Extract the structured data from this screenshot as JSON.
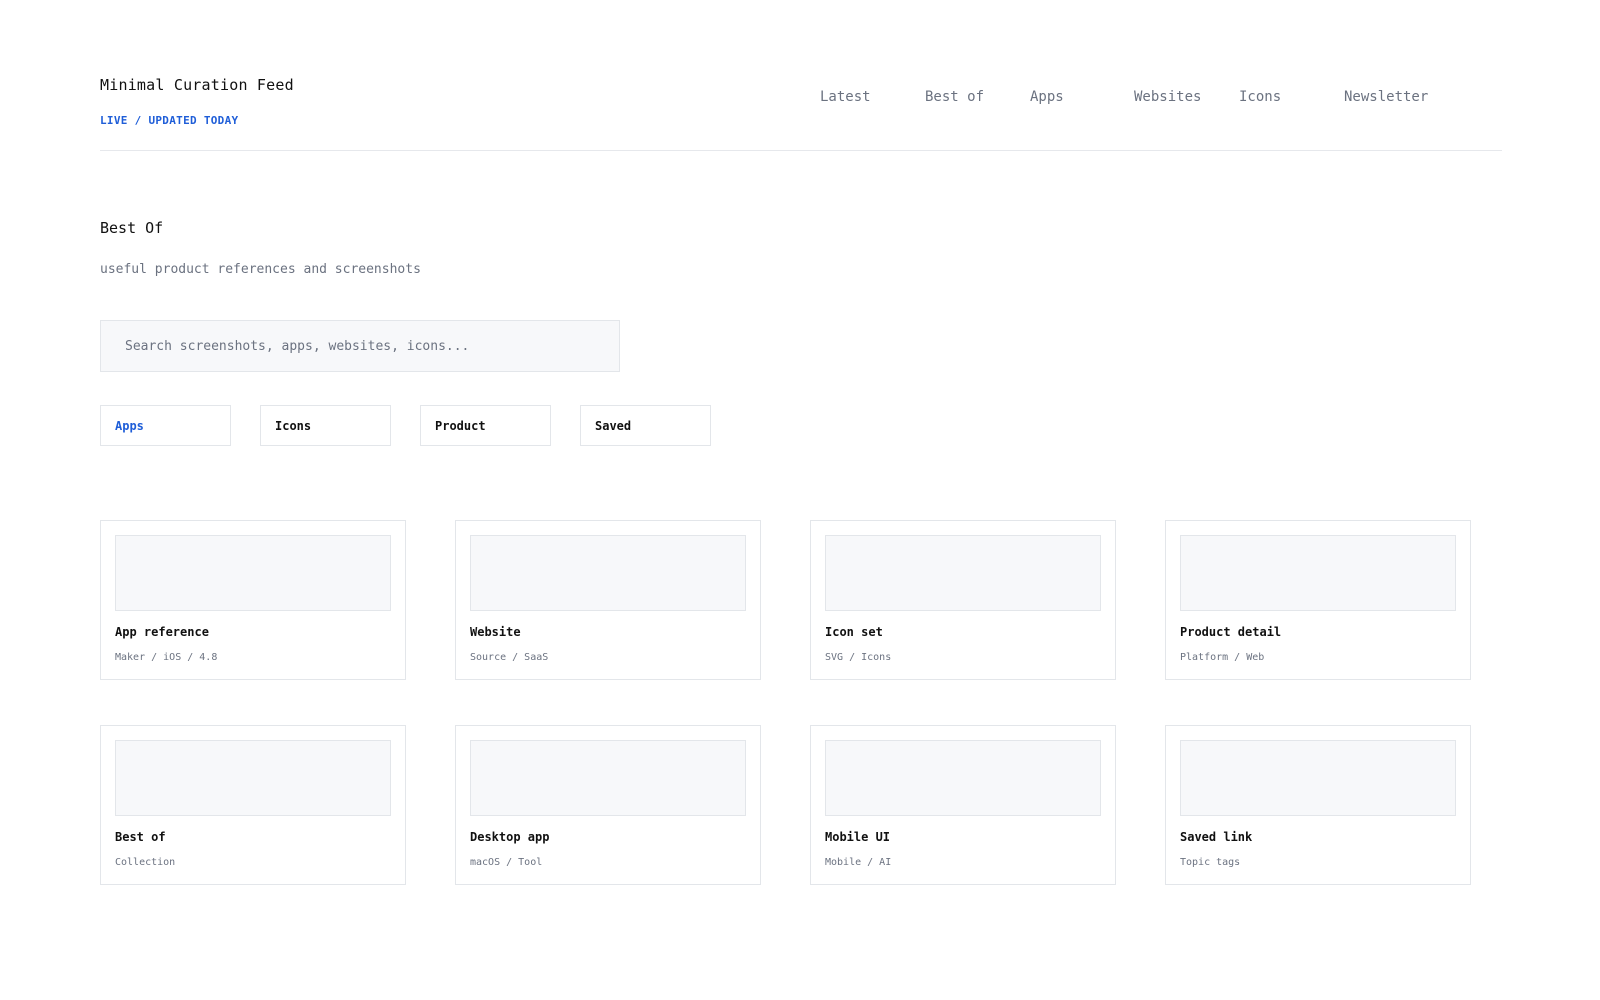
{
  "header": {
    "title": "Minimal Curation Feed",
    "status": "LIVE / UPDATED TODAY",
    "nav": [
      "Latest",
      "Best of",
      "Apps",
      "Websites",
      "Icons",
      "Newsletter"
    ]
  },
  "section": {
    "title": "Best Of",
    "subtitle": "useful product references and screenshots"
  },
  "search": {
    "placeholder": "Search screenshots, apps, websites, icons..."
  },
  "filters": [
    "Apps",
    "Icons",
    "Product",
    "Saved"
  ],
  "active_filter": "Apps",
  "cards": [
    {
      "title": "App reference",
      "meta": "Maker / iOS / 4.8"
    },
    {
      "title": "Website",
      "meta": "Source / SaaS"
    },
    {
      "title": "Icon set",
      "meta": "SVG / Icons"
    },
    {
      "title": "Product detail",
      "meta": "Platform / Web"
    },
    {
      "title": "Best of",
      "meta": "Collection"
    },
    {
      "title": "Desktop app",
      "meta": "macOS / Tool"
    },
    {
      "title": "Mobile UI",
      "meta": "Mobile / AI"
    },
    {
      "title": "Saved link",
      "meta": "Topic tags"
    }
  ],
  "colors": {
    "accent": "#1f5ed8",
    "muted_text": "#6b7280",
    "border": "#e3e6ea",
    "placeholder_fill": "#f7f8fa"
  }
}
